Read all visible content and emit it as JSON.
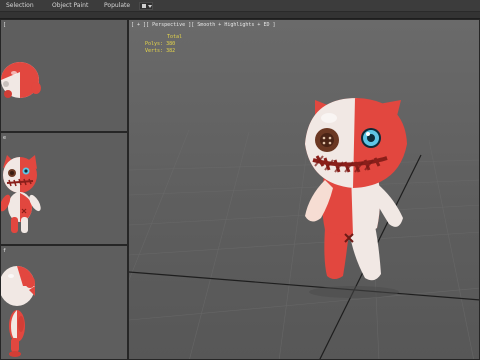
{
  "menubar": {
    "items": [
      "Selection",
      "Object Paint",
      "Populate"
    ]
  },
  "viewports": {
    "top": {
      "label": "["
    },
    "front": {
      "label": "e"
    },
    "left": {
      "label": "f"
    },
    "perspective": {
      "label": "[ + ][ Perspective ][ Smooth + Highlights + ED ]"
    }
  },
  "stats": {
    "total_label": "Total",
    "polys_label": "Polys:",
    "polys_value": "380",
    "verts_label": "Verts:",
    "verts_value": "382"
  },
  "colors": {
    "body_red": "#e2473f",
    "body_white": "#f1e8e4",
    "stitch": "#8a1f1a",
    "eye_blue": "#5fc6e6",
    "stats_text": "#e6d64a"
  }
}
